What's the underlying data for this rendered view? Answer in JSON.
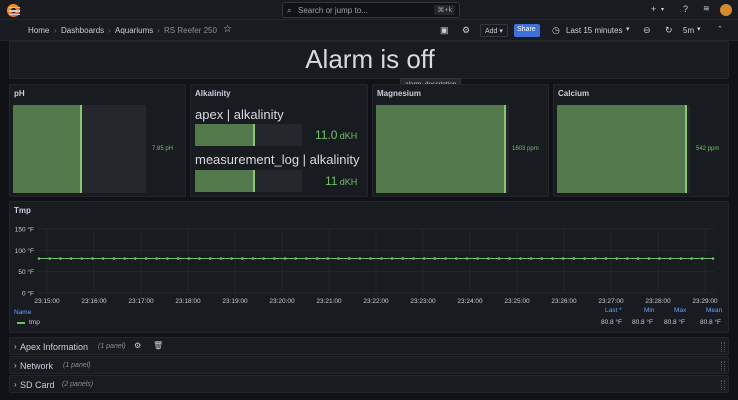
{
  "search": {
    "placeholder": "Search or jump to...",
    "shortcut": "⌘+k"
  },
  "breadcrumb": {
    "home": "Home",
    "dashboards": "Dashboards",
    "folder": "Aquariums",
    "current": "RS Reefer 250"
  },
  "toolbar": {
    "add_label": "Add",
    "share_label": "Share",
    "time_range": "Last 15 minutes",
    "refresh_interval": "5m"
  },
  "alarm": {
    "text": "Alarm is off",
    "tooltip": "alarm_description"
  },
  "ph": {
    "title": "pH",
    "value": "7.85 pH",
    "fill": 0.52
  },
  "alkalinity": {
    "title": "Alkalinity",
    "items": [
      {
        "label": "apex | alkalinity",
        "value": "11.0",
        "unit": "dKH",
        "fill": 0.56
      },
      {
        "label": "measurement_log | alkalinity",
        "value": "11",
        "unit": "dKH",
        "fill": 0.56
      }
    ]
  },
  "magnesium": {
    "title": "Magnesium",
    "value": "1603 ppm",
    "fill": 0.98
  },
  "calcium": {
    "title": "Calcium",
    "value": "542 ppm",
    "fill": 0.98
  },
  "tmp": {
    "title": "Tmp",
    "y_ticks": [
      "150 °F",
      "100 °F",
      "50 °F",
      "0 °F"
    ],
    "x_ticks": [
      "23:15:00",
      "23:16:00",
      "23:17:00",
      "23:18:00",
      "23:19:00",
      "23:20:00",
      "23:21:00",
      "23:22:00",
      "23:23:00",
      "23:24:00",
      "23:25:00",
      "23:26:00",
      "23:27:00",
      "23:28:00",
      "23:29:00"
    ],
    "legend": {
      "headers": {
        "name": "Name",
        "last": "Last *",
        "min": "Min",
        "max": "Max",
        "mean": "Mean"
      },
      "series": {
        "name": "tmp",
        "last": "80.8 °F",
        "min": "80.8 °F",
        "max": "80.8 °F",
        "mean": "80.8 °F"
      }
    },
    "series_color": "#73bf69"
  },
  "chart_data": {
    "type": "line",
    "title": "Tmp",
    "x": [
      "23:15:00",
      "23:16:00",
      "23:17:00",
      "23:18:00",
      "23:19:00",
      "23:20:00",
      "23:21:00",
      "23:22:00",
      "23:23:00",
      "23:24:00",
      "23:25:00",
      "23:26:00",
      "23:27:00",
      "23:28:00",
      "23:29:00"
    ],
    "ylim": [
      0,
      150
    ],
    "series": [
      {
        "name": "tmp",
        "values": [
          80.8,
          80.8,
          80.8,
          80.8,
          80.8,
          80.8,
          80.8,
          80.8,
          80.8,
          80.8,
          80.8,
          80.8,
          80.8,
          80.8,
          80.8
        ]
      }
    ],
    "grid": true,
    "legend": "bottom"
  },
  "rows": [
    {
      "title": "Apex Information",
      "count": "(1 panel)"
    },
    {
      "title": "Network",
      "count": "(1 panel)"
    },
    {
      "title": "SD Card",
      "count": "(2 panels)"
    }
  ]
}
